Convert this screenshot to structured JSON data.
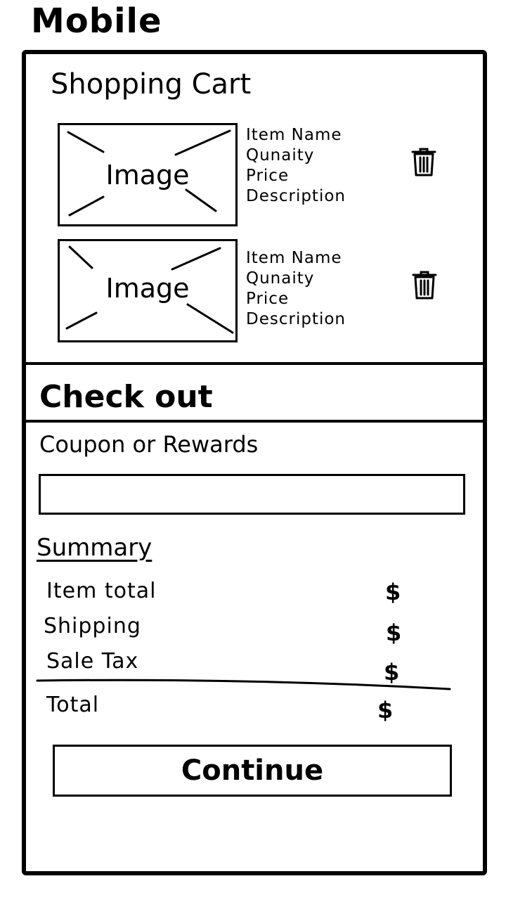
{
  "device_label": "Mobile",
  "cart": {
    "title": "Shopping Cart",
    "items": [
      {
        "image_label": "Image",
        "name": "Item Name",
        "quantity": "Qunaity",
        "price": "Price",
        "description": "Description",
        "delete_icon": "trash-icon"
      },
      {
        "image_label": "Image",
        "name": "Item Name",
        "quantity": "Qunaity",
        "price": "Price",
        "description": "Description",
        "delete_icon": "trash-icon"
      }
    ]
  },
  "checkout": {
    "title": "Check out",
    "coupon_label": "Coupon or Rewards",
    "coupon_value": ""
  },
  "summary": {
    "title": "Summary",
    "rows": [
      {
        "label": "Item total",
        "value": "$"
      },
      {
        "label": "Shipping",
        "value": "$"
      },
      {
        "label": "Sale Tax",
        "value": "$"
      }
    ],
    "total": {
      "label": "Total",
      "value": "$"
    }
  },
  "continue_label": "Continue"
}
